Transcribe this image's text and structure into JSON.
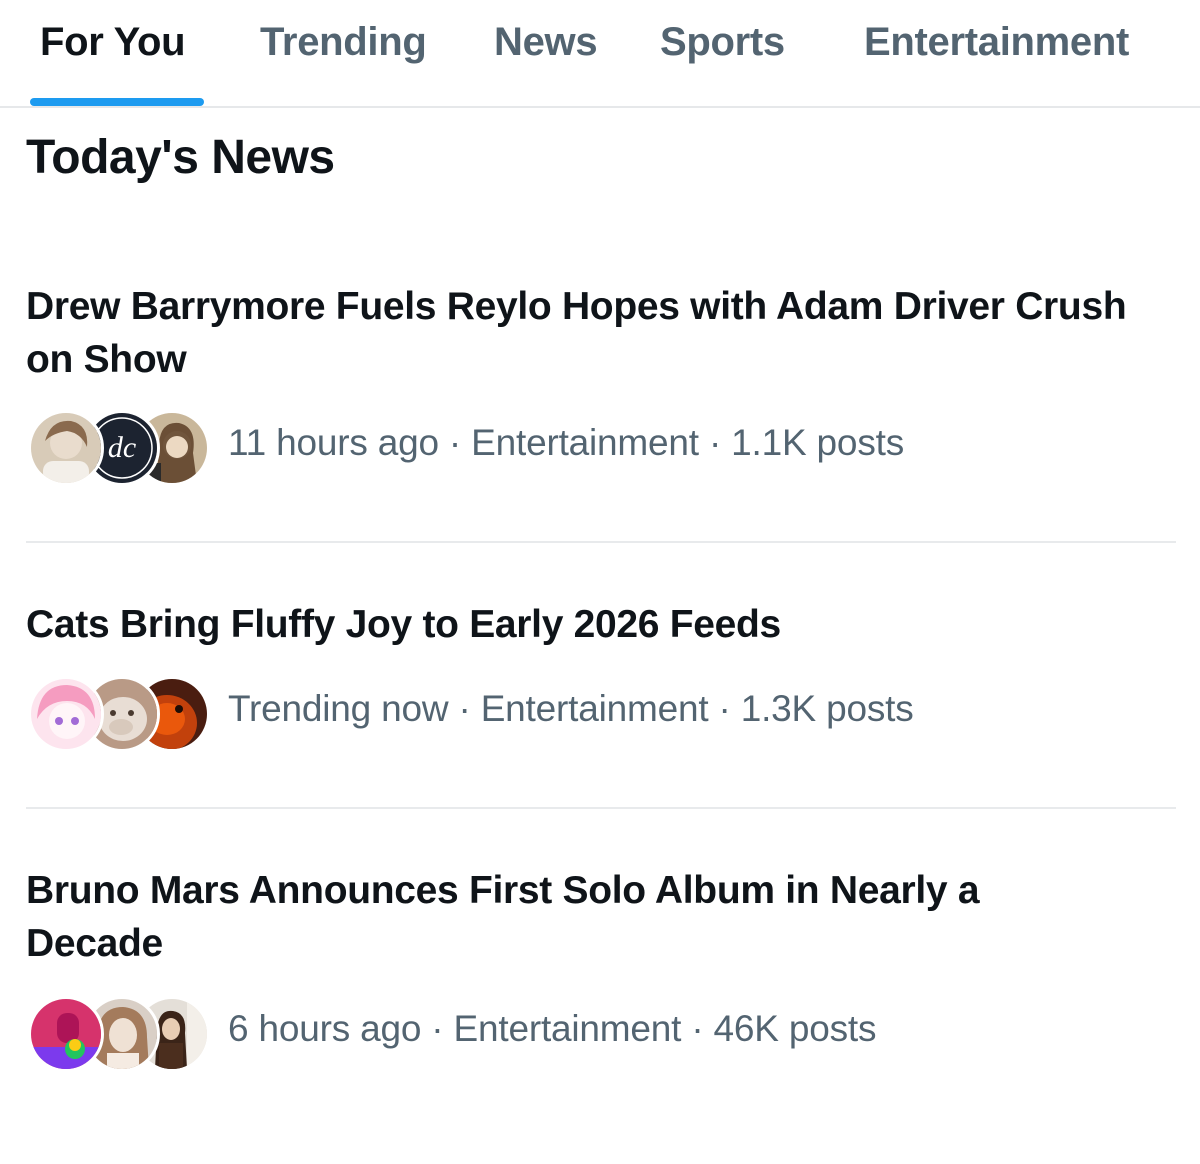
{
  "tabs": [
    {
      "label": "For You",
      "active": true
    },
    {
      "label": "Trending",
      "active": false
    },
    {
      "label": "News",
      "active": false
    },
    {
      "label": "Sports",
      "active": false
    },
    {
      "label": "Entertainment",
      "active": false
    }
  ],
  "section_title": "Today's News",
  "stories": [
    {
      "headline": "Drew Barrymore Fuels Reylo Hopes with Adam Driver Crush on Show",
      "meta": "11 hours ago · Entertainment · 1.1K posts",
      "avatar_monogram": "dc"
    },
    {
      "headline": "Cats Bring Fluffy Joy to Early 2026 Feeds",
      "meta": "Trending now · Entertainment · 1.3K posts"
    },
    {
      "headline": "Bruno Mars Announces First Solo Album in Nearly a Decade",
      "meta": "6 hours ago · Entertainment · 46K posts"
    }
  ],
  "colors": {
    "accent": "#1d9bf0",
    "text_primary": "#0f1419",
    "text_secondary": "#536471",
    "divider": "#e8eaec"
  }
}
